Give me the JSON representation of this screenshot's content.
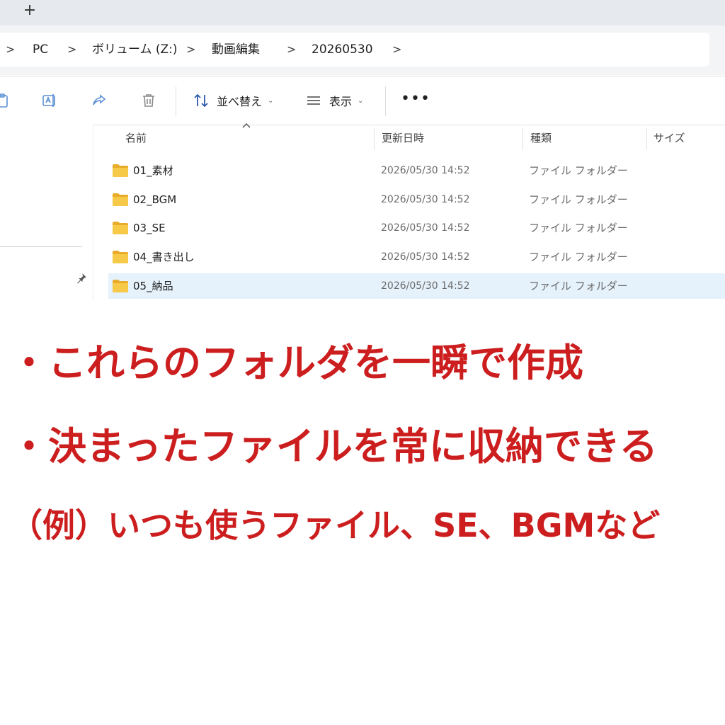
{
  "window": {
    "new_tab_label": "+"
  },
  "address": {
    "crumbs": [
      "PC",
      "ボリューム (Z:)",
      "動画編集",
      "20260530"
    ],
    "separator": ">"
  },
  "toolbar": {
    "sort_label": "並べ替え",
    "view_label": "表示",
    "more_label": "•••",
    "icons": [
      "paste-icon",
      "rename-icon",
      "share-icon",
      "delete-icon",
      "sort-icon",
      "view-icon"
    ]
  },
  "columns": {
    "name": "名前",
    "modified": "更新日時",
    "type": "種類",
    "size": "サイズ",
    "sorted_by": "name"
  },
  "files": [
    {
      "name": "01_素材",
      "modified": "2026/05/30 14:52",
      "type": "ファイル フォルダー",
      "selected": false
    },
    {
      "name": "02_BGM",
      "modified": "2026/05/30 14:52",
      "type": "ファイル フォルダー",
      "selected": false
    },
    {
      "name": "03_SE",
      "modified": "2026/05/30 14:52",
      "type": "ファイル フォルダー",
      "selected": false
    },
    {
      "name": "04_書き出し",
      "modified": "2026/05/30 14:52",
      "type": "ファイル フォルダー",
      "selected": false
    },
    {
      "name": "05_納品",
      "modified": "2026/05/30 14:52",
      "type": "ファイル フォルダー",
      "selected": true
    }
  ],
  "captions": [
    "・これらのフォルダを一瞬で作成",
    "・決まったファイルを常に収納できる",
    "（例）いつも使うファイル、SE、BGMなど"
  ],
  "colors": {
    "caption": "#cc1e1e",
    "selection": "#e5f1fb",
    "folder": "#f7c948"
  }
}
